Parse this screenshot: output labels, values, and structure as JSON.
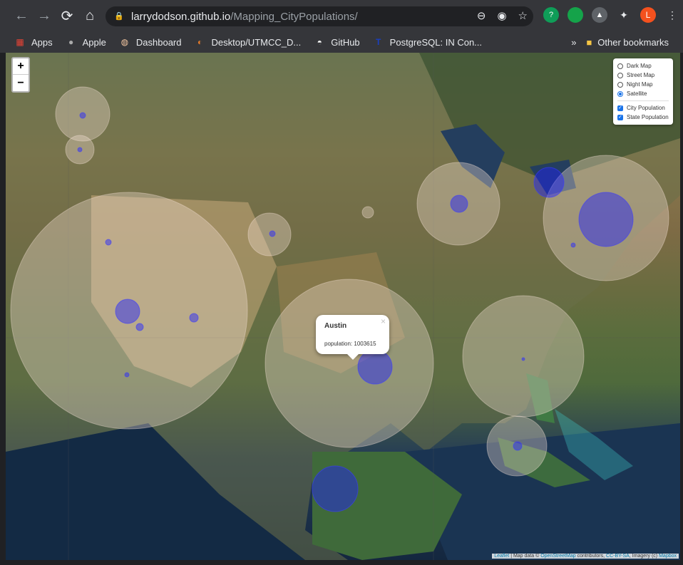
{
  "browser": {
    "url_host": "larrydodson.github.io",
    "url_path": "/Mapping_CityPopulations/",
    "profile_initial": "L",
    "bookmarks": [
      {
        "label": "Apps",
        "icon": "apps-grid-icon"
      },
      {
        "label": "Apple",
        "icon": "apple-icon"
      },
      {
        "label": "Dashboard",
        "icon": "dashboard-icon"
      },
      {
        "label": "Desktop/UTMCC_D...",
        "icon": "utmcc-icon"
      },
      {
        "label": "GitHub",
        "icon": "github-icon"
      },
      {
        "label": "PostgreSQL: IN Con...",
        "icon": "postgres-icon"
      }
    ],
    "other_bookmarks": "Other bookmarks"
  },
  "map": {
    "zoom_in": "+",
    "zoom_out": "−",
    "layers": {
      "base": [
        "Dark Map",
        "Street Map",
        "Night Map",
        "Satellite"
      ],
      "selected_base": "Satellite",
      "overlays": [
        "City Population",
        "State Population"
      ]
    },
    "popup": {
      "city": "Austin",
      "text": "population: 1003615"
    },
    "attribution": {
      "leaflet": "Leaflet",
      "text1": " | Map data © ",
      "osm": "OpenStreetMap",
      "text2": " contributors, ",
      "license": "CC-BY-SA",
      "text3": ", Imagery (c) ",
      "mapbox": "Mapbox"
    },
    "colors": {
      "state_circle": "#f5e1d7",
      "city_circle": "#1e1eff"
    }
  }
}
